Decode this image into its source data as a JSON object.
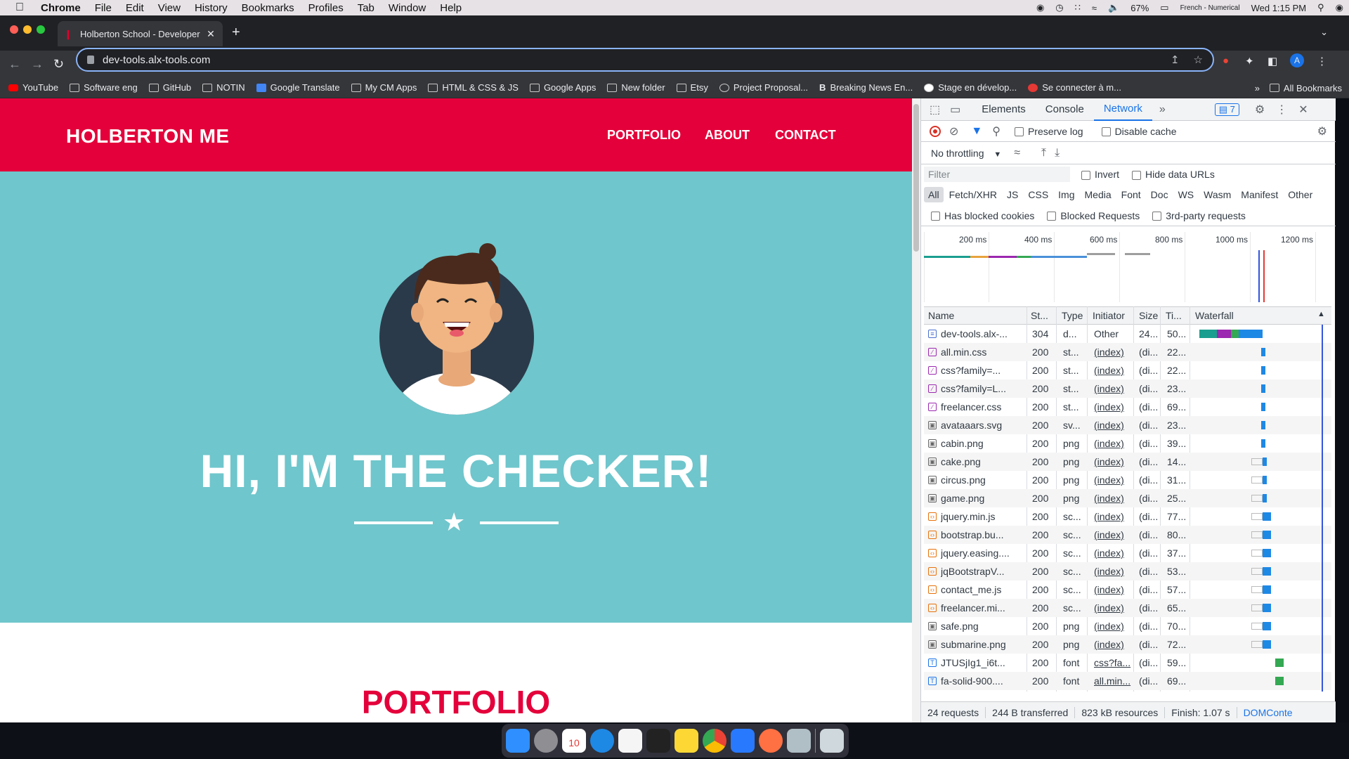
{
  "menubar": {
    "app": "Chrome",
    "items": [
      "File",
      "Edit",
      "View",
      "History",
      "Bookmarks",
      "Profiles",
      "Tab",
      "Window",
      "Help"
    ],
    "battery": "67%",
    "input_source": "French - Numerical",
    "clock": "Wed 1:15 PM"
  },
  "tab": {
    "title": "Holberton School - Developer"
  },
  "address": {
    "url": "dev-tools.alx-tools.com"
  },
  "bookmarks": {
    "items": [
      "YouTube",
      "Software eng",
      "GitHub",
      "NOTIN",
      "Google Translate",
      "My CM Apps",
      "HTML & CSS & JS",
      "Google Apps",
      "New folder",
      "Etsy",
      "Project Proposal...",
      "Breaking News En...",
      "Stage en dévelop...",
      "Se connecter à m..."
    ],
    "all": "All Bookmarks"
  },
  "site": {
    "brand": "HOLBERTON ME",
    "nav": [
      "PORTFOLIO",
      "ABOUT",
      "CONTACT"
    ],
    "hero_title": "HI, I'M THE CHECKER!",
    "portfolio_title": "PORTFOLIO",
    "colors": {
      "primary": "#e4003a",
      "hero": "#6fc6cc"
    }
  },
  "devtools": {
    "tabs": [
      "Elements",
      "Console",
      "Network"
    ],
    "active_tab": "Network",
    "issues_count": "7",
    "preserve_log": "Preserve log",
    "disable_cache": "Disable cache",
    "throttling": "No throttling",
    "filter_placeholder": "Filter",
    "invert": "Invert",
    "hide_data_urls": "Hide data URLs",
    "types": [
      "All",
      "Fetch/XHR",
      "JS",
      "CSS",
      "Img",
      "Media",
      "Font",
      "Doc",
      "WS",
      "Wasm",
      "Manifest",
      "Other"
    ],
    "has_blocked_cookies": "Has blocked cookies",
    "blocked_requests": "Blocked Requests",
    "third_party": "3rd-party requests",
    "overview_ticks": [
      "200 ms",
      "400 ms",
      "600 ms",
      "800 ms",
      "1000 ms",
      "1200 ms"
    ],
    "columns": [
      "Name",
      "St...",
      "Type",
      "Initiator",
      "Size",
      "Ti...",
      "Waterfall"
    ],
    "rows": [
      {
        "name": "dev-tools.alx-...",
        "status": "304",
        "type": "d...",
        "initiator": "Other",
        "size": "24...",
        "time": "50...",
        "icon": "doc"
      },
      {
        "name": "all.min.css",
        "status": "200",
        "type": "st...",
        "initiator": "(index)",
        "size": "(di...",
        "time": "22...",
        "icon": "css"
      },
      {
        "name": "css?family=...",
        "status": "200",
        "type": "st...",
        "initiator": "(index)",
        "size": "(di...",
        "time": "22...",
        "icon": "css"
      },
      {
        "name": "css?family=L...",
        "status": "200",
        "type": "st...",
        "initiator": "(index)",
        "size": "(di...",
        "time": "23...",
        "icon": "css"
      },
      {
        "name": "freelancer.css",
        "status": "200",
        "type": "st...",
        "initiator": "(index)",
        "size": "(di...",
        "time": "69...",
        "icon": "css"
      },
      {
        "name": "avataaars.svg",
        "status": "200",
        "type": "sv...",
        "initiator": "(index)",
        "size": "(di...",
        "time": "23...",
        "icon": "img"
      },
      {
        "name": "cabin.png",
        "status": "200",
        "type": "png",
        "initiator": "(index)",
        "size": "(di...",
        "time": "39...",
        "icon": "img"
      },
      {
        "name": "cake.png",
        "status": "200",
        "type": "png",
        "initiator": "(index)",
        "size": "(di...",
        "time": "14...",
        "icon": "img"
      },
      {
        "name": "circus.png",
        "status": "200",
        "type": "png",
        "initiator": "(index)",
        "size": "(di...",
        "time": "31...",
        "icon": "img"
      },
      {
        "name": "game.png",
        "status": "200",
        "type": "png",
        "initiator": "(index)",
        "size": "(di...",
        "time": "25...",
        "icon": "img"
      },
      {
        "name": "jquery.min.js",
        "status": "200",
        "type": "sc...",
        "initiator": "(index)",
        "size": "(di...",
        "time": "77...",
        "icon": "js"
      },
      {
        "name": "bootstrap.bu...",
        "status": "200",
        "type": "sc...",
        "initiator": "(index)",
        "size": "(di...",
        "time": "80...",
        "icon": "js"
      },
      {
        "name": "jquery.easing....",
        "status": "200",
        "type": "sc...",
        "initiator": "(index)",
        "size": "(di...",
        "time": "37...",
        "icon": "js"
      },
      {
        "name": "jqBootstrapV...",
        "status": "200",
        "type": "sc...",
        "initiator": "(index)",
        "size": "(di...",
        "time": "53...",
        "icon": "js"
      },
      {
        "name": "contact_me.js",
        "status": "200",
        "type": "sc...",
        "initiator": "(index)",
        "size": "(di...",
        "time": "57...",
        "icon": "js"
      },
      {
        "name": "freelancer.mi...",
        "status": "200",
        "type": "sc...",
        "initiator": "(index)",
        "size": "(di...",
        "time": "65...",
        "icon": "js"
      },
      {
        "name": "safe.png",
        "status": "200",
        "type": "png",
        "initiator": "(index)",
        "size": "(di...",
        "time": "70...",
        "icon": "img"
      },
      {
        "name": "submarine.png",
        "status": "200",
        "type": "png",
        "initiator": "(index)",
        "size": "(di...",
        "time": "72...",
        "icon": "img"
      },
      {
        "name": "JTUSjIg1_i6t...",
        "status": "200",
        "type": "font",
        "initiator": "css?fa...",
        "size": "(di...",
        "time": "59...",
        "icon": "font"
      },
      {
        "name": "fa-solid-900....",
        "status": "200",
        "type": "font",
        "initiator": "all.min...",
        "size": "(di...",
        "time": "69...",
        "icon": "font"
      }
    ],
    "footer": {
      "requests": "24 requests",
      "transferred": "244 B transferred",
      "resources": "823 kB resources",
      "finish": "Finish: 1.07 s",
      "domcontent": "DOMConte"
    }
  },
  "dock": {
    "calendar_day": "10"
  }
}
